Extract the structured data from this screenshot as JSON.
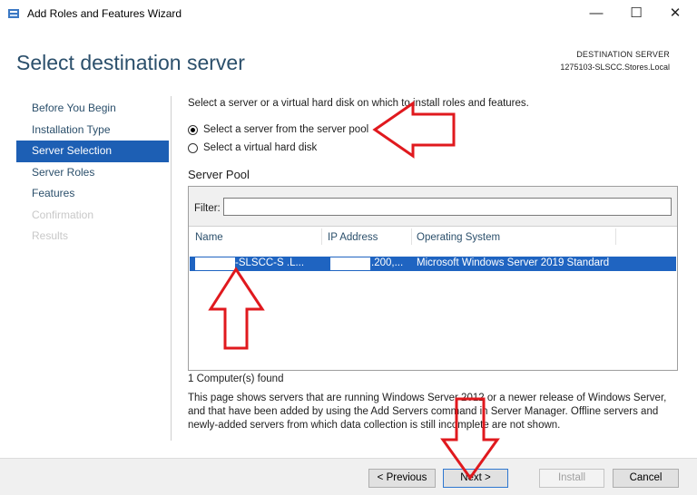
{
  "window": {
    "title": "Add Roles and Features Wizard",
    "controls": {
      "minimize": "—",
      "maximize": "☐",
      "close": "✕"
    }
  },
  "header": {
    "page_title": "Select destination server",
    "dest_label": "DESTINATION SERVER",
    "dest_name": "1275103-SLSCC.Stores.Local"
  },
  "nav": {
    "items": [
      {
        "label": "Before You Begin",
        "state": "normal"
      },
      {
        "label": "Installation Type",
        "state": "normal"
      },
      {
        "label": "Server Selection",
        "state": "active"
      },
      {
        "label": "Server Roles",
        "state": "normal"
      },
      {
        "label": "Features",
        "state": "normal"
      },
      {
        "label": "Confirmation",
        "state": "disabled"
      },
      {
        "label": "Results",
        "state": "disabled"
      }
    ]
  },
  "main": {
    "instruction": "Select a server or a virtual hard disk on which to install roles and features.",
    "option_pool": "Select a server from the server pool",
    "option_vhd": "Select a virtual hard disk",
    "pool_title": "Server Pool",
    "filter_label": "Filter:",
    "filter_value": "",
    "columns": [
      "Name",
      "IP Address",
      "Operating System"
    ],
    "rows": [
      {
        "name": "-SLSCC-S     .L...",
        "ip": ".200,...",
        "os": "Microsoft Windows Server 2019 Standard"
      }
    ],
    "found": "1 Computer(s) found",
    "note": "This page shows servers that are running Windows Server 2012 or a newer release of Windows Server, and that have been added by using the Add Servers command in Server Manager. Offline servers and newly-added servers from which data collection is still incomplete are not shown."
  },
  "footer": {
    "previous": "< Previous",
    "next": "Next >",
    "install": "Install",
    "cancel": "Cancel"
  },
  "colors": {
    "accent": "#1d5fb4",
    "selected_row": "#1f64c1",
    "title_blue": "#2b4f6b",
    "annotation_red": "#e0191e"
  }
}
